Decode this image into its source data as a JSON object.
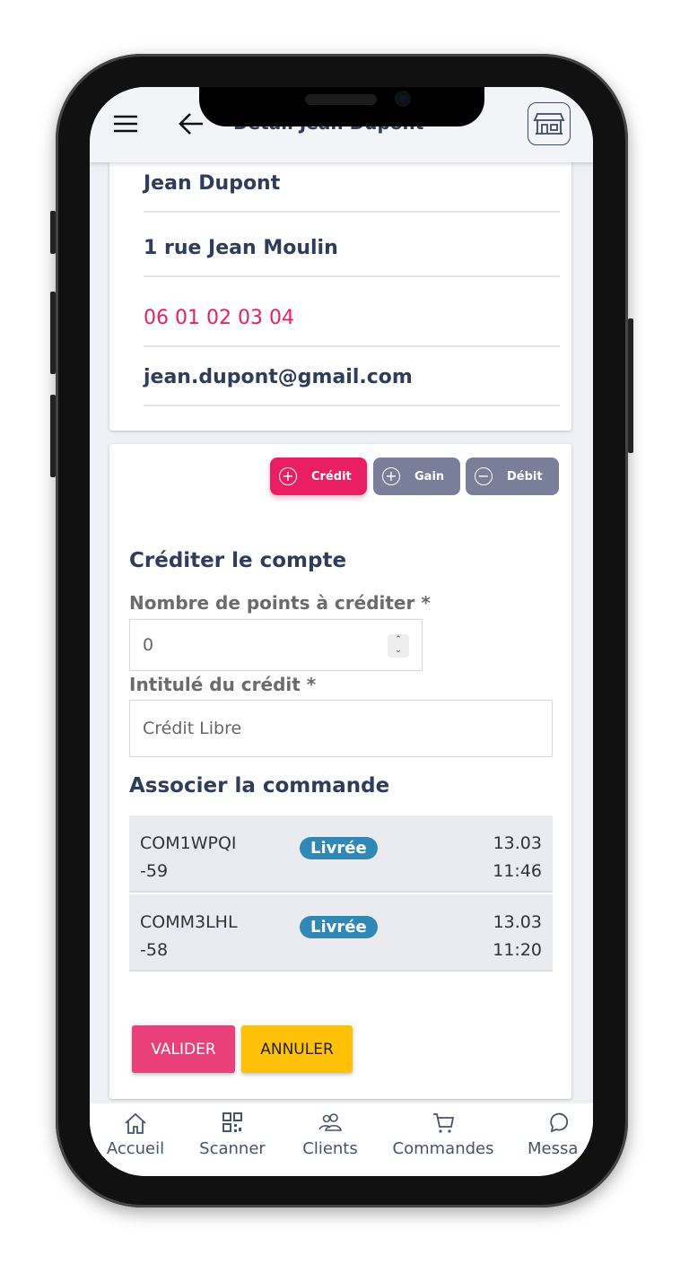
{
  "header": {
    "title": "Détail Jean Dupont"
  },
  "client": {
    "name": "Jean Dupont",
    "address": "1 rue Jean Moulin",
    "phone": "06 01 02 03 04",
    "email": "jean.dupont@gmail.com"
  },
  "tabs": [
    {
      "label": "Crédit",
      "icon": "plus-circle-icon",
      "active": true
    },
    {
      "label": "Gain",
      "icon": "plus-circle-icon"
    },
    {
      "label": "Débit",
      "icon": "minus-circle-icon"
    }
  ],
  "form": {
    "title": "Créditer le compte",
    "points_label": "Nombre de points à créditer *",
    "points_value": "0",
    "wording_label": "Intitulé du crédit *",
    "wording_value": "Crédit Libre",
    "orders_title": "Associer la commande"
  },
  "orders": [
    {
      "ref1": "COM1WPQI",
      "ref2": "-59",
      "status": "Livrée",
      "date": "13.03",
      "time": "11:46"
    },
    {
      "ref1": "COMM3LHL",
      "ref2": "-58",
      "status": "Livrée",
      "date": "13.03",
      "time": "11:20"
    }
  ],
  "actions": {
    "validate": "VALIDER",
    "cancel": "ANNULER"
  },
  "nav": [
    {
      "label": "Accueil",
      "icon": "home-icon"
    },
    {
      "label": "Scanner",
      "icon": "qr-code-icon"
    },
    {
      "label": "Clients",
      "icon": "users-icon"
    },
    {
      "label": "Commandes",
      "icon": "cart-icon"
    },
    {
      "label": "Messa",
      "icon": "chat-icon"
    }
  ],
  "colors": {
    "primary": "#e91e63",
    "secondary": "#7a7f99",
    "accent": "#ffc107",
    "badge": "#2f88b8"
  }
}
